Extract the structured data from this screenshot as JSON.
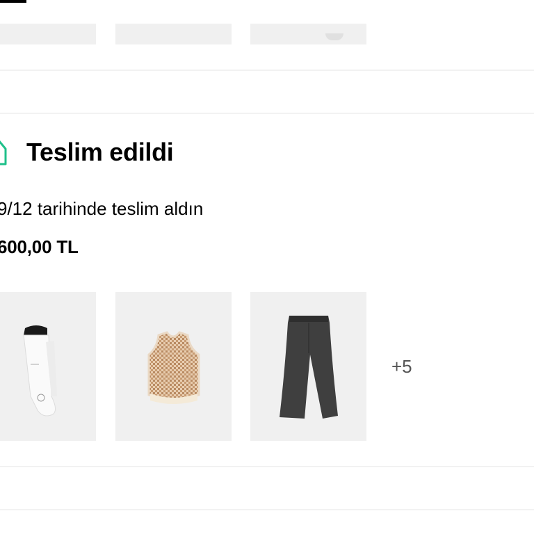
{
  "order": {
    "status": "Teslim edildi",
    "delivery_note": "9/12 tarihinde teslim aldın",
    "total": "600,00 TL",
    "more_items": "+5"
  },
  "products": [
    {
      "icon": "socks-image"
    },
    {
      "icon": "knit-vest-image"
    },
    {
      "icon": "trousers-image"
    }
  ],
  "colors": {
    "status_accent": "#1fc08a",
    "thumb_bg": "#f0f0f0"
  }
}
